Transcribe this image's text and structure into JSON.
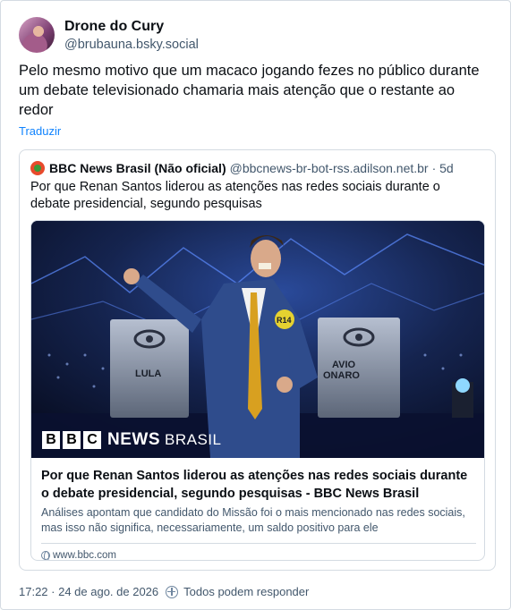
{
  "post": {
    "author_name": "Drone do Cury",
    "author_handle": "@brubauna.bsky.social",
    "text": "Pelo mesmo motivo que um macaco jogando fezes no público durante um debate televisionado chamaria mais atenção que o restante ao redor",
    "translate_label": "Traduzir",
    "timestamp": "17:22 · 24 de ago. de 2026",
    "reply_setting": "Todos podem responder"
  },
  "quote": {
    "author_name": "BBC News Brasil (Não oficial)",
    "author_handle": "@bbcnews-br-bot-rss.adilson.net.br",
    "age": "· 5d",
    "text": "Por que Renan Santos liderou as atenções nas redes sociais durante o debate presidencial, segundo pesquisas",
    "card": {
      "logo_letters": [
        "B",
        "B",
        "C"
      ],
      "logo_news": "NEWS",
      "logo_brasil": "BRASIL",
      "podium_left": "LULA",
      "podium_right_1": "AVIO",
      "podium_right_2": "ONARO",
      "badge": "R14",
      "title": "Por que Renan Santos liderou as atenções nas redes sociais durante o debate presidencial, segundo pesquisas - BBC News Brasil",
      "description": "Análises apontam que candidato do Missão foi o mais mencionado nas redes sociais, mas isso não significa, necessariamente, um saldo positivo para ele",
      "domain": "www.bbc.com"
    }
  },
  "icons": {
    "globe": "globe-icon",
    "reply": "reply-settings-icon"
  },
  "colors": {
    "link": "#1083fe",
    "secondary_text": "#42576c",
    "border": "#d4dbe2"
  }
}
